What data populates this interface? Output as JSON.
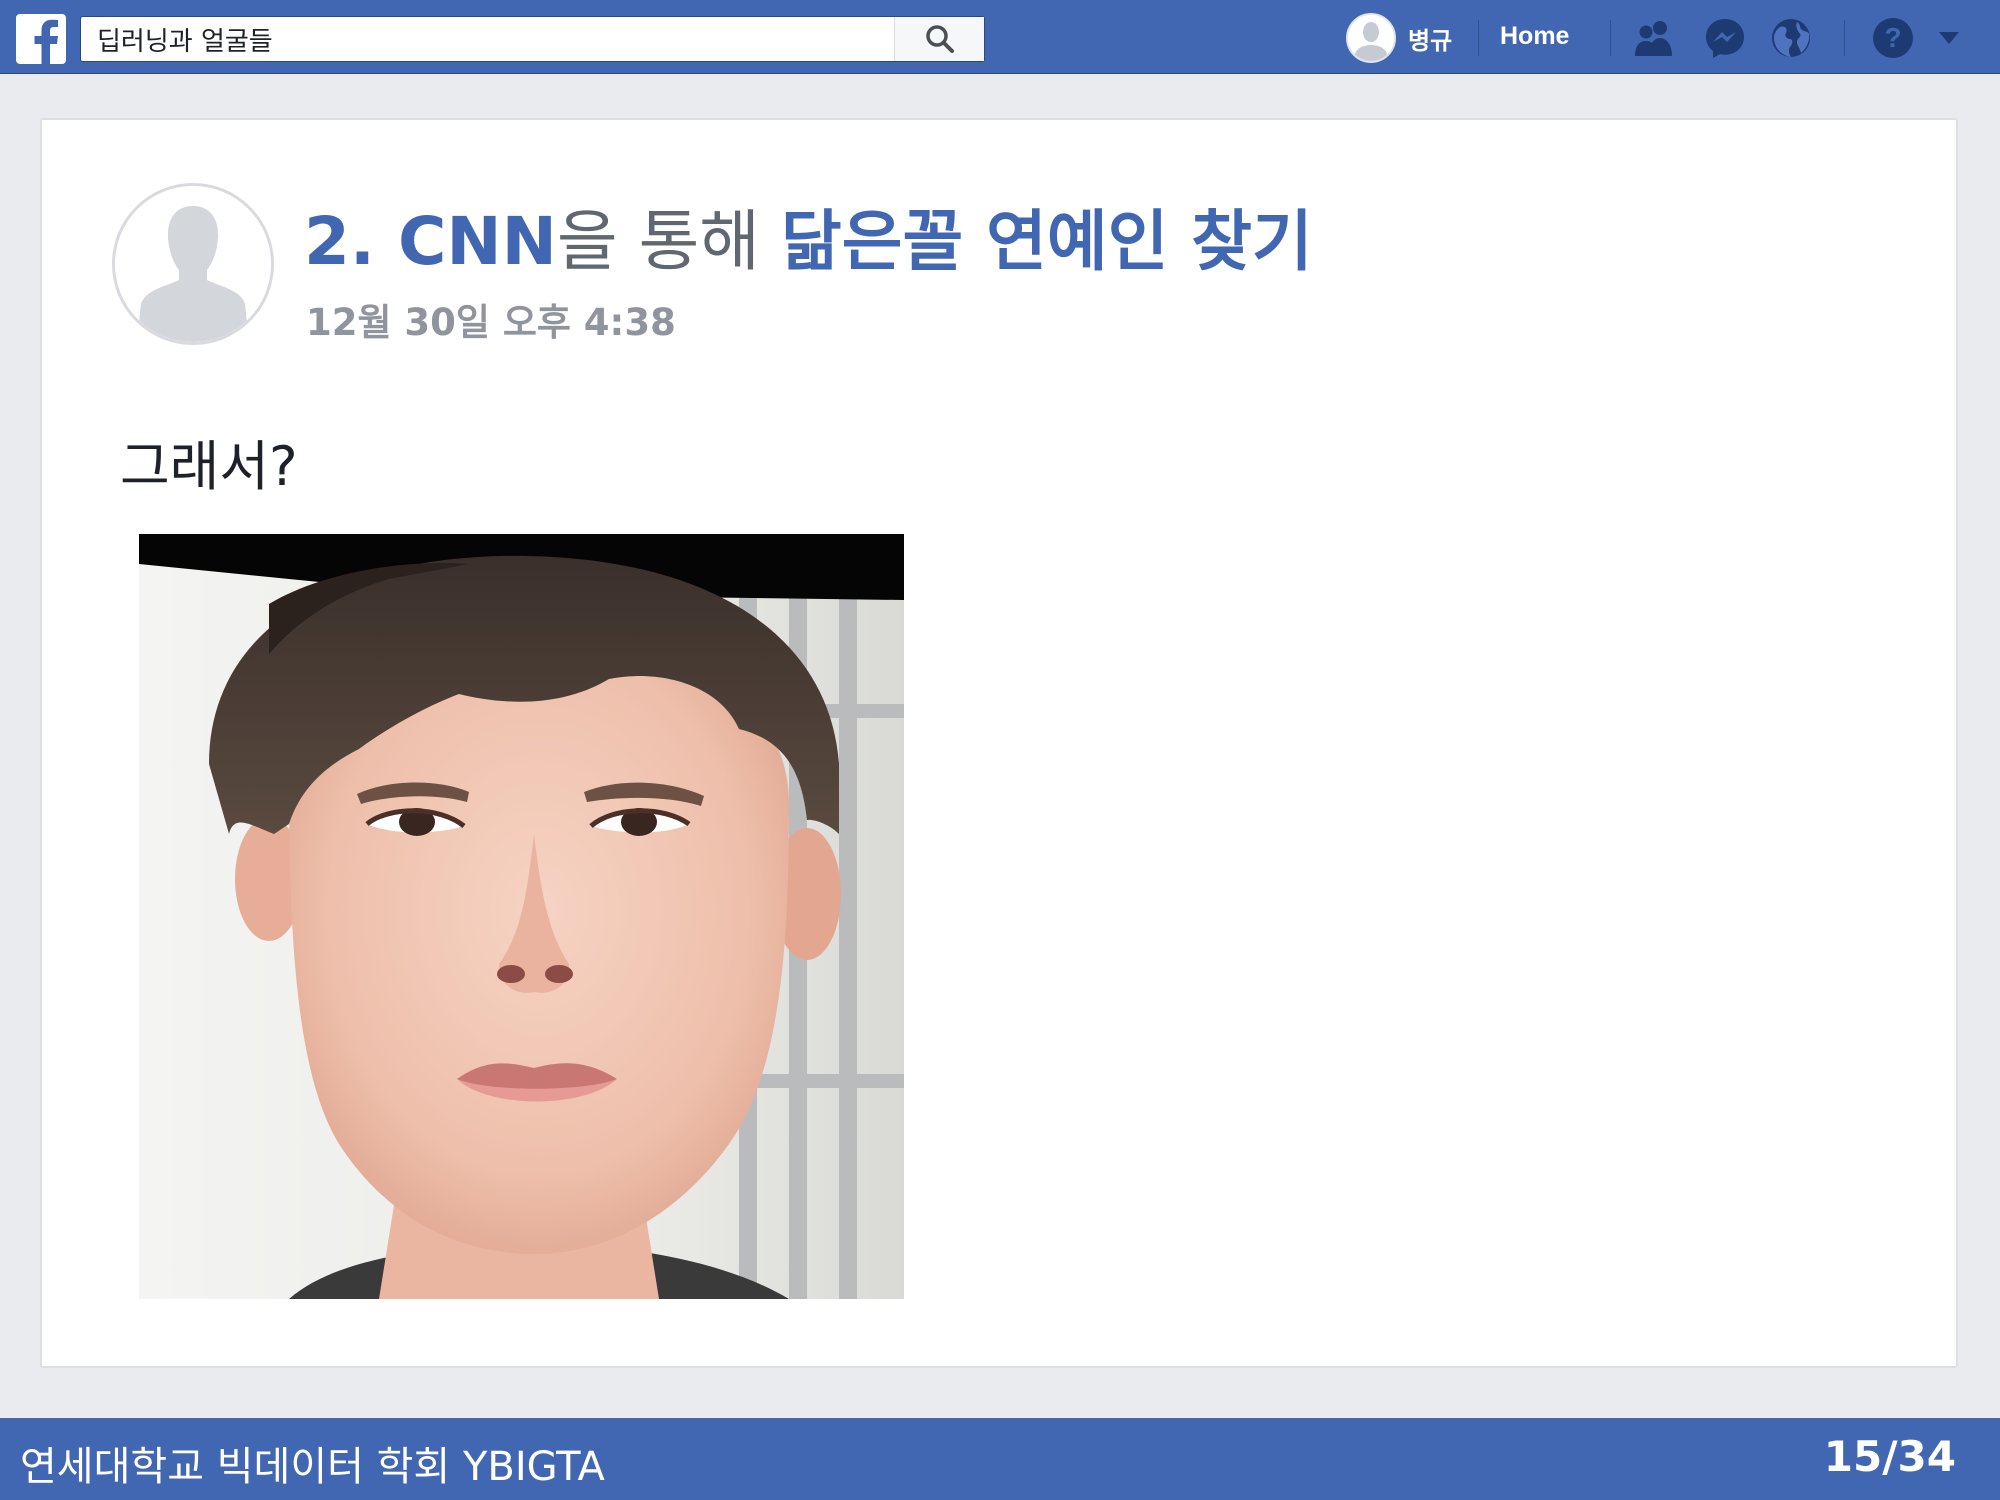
{
  "header": {
    "brand_icon": "facebook-f-icon",
    "search": {
      "value": "딥러닝과 얼굴들",
      "icon": "search-icon"
    },
    "user": {
      "name": "병규",
      "avatar_icon": "default-avatar-icon"
    },
    "home_label": "Home",
    "nav_icons": [
      "friends-icon",
      "messenger-icon",
      "globe-icon",
      "help-icon",
      "dropdown-arrow-icon"
    ]
  },
  "post": {
    "title": {
      "part1": "2. CNN",
      "part2": "을 통해 ",
      "part3": "닮은꼴 연예인 찾기"
    },
    "timestamp": "12월 30일 오후 4:38",
    "body_text": "그래서?",
    "author_avatar_icon": "default-avatar-icon",
    "photo": "face-photo"
  },
  "footer": {
    "organization": "연세대학교 빅데이터 학회 YBIGTA",
    "page_number": "15/34"
  },
  "colors": {
    "brand_blue": "#4267b2",
    "background": "#e9ebee",
    "title_gray": "#616770",
    "time_gray": "#90949c"
  }
}
